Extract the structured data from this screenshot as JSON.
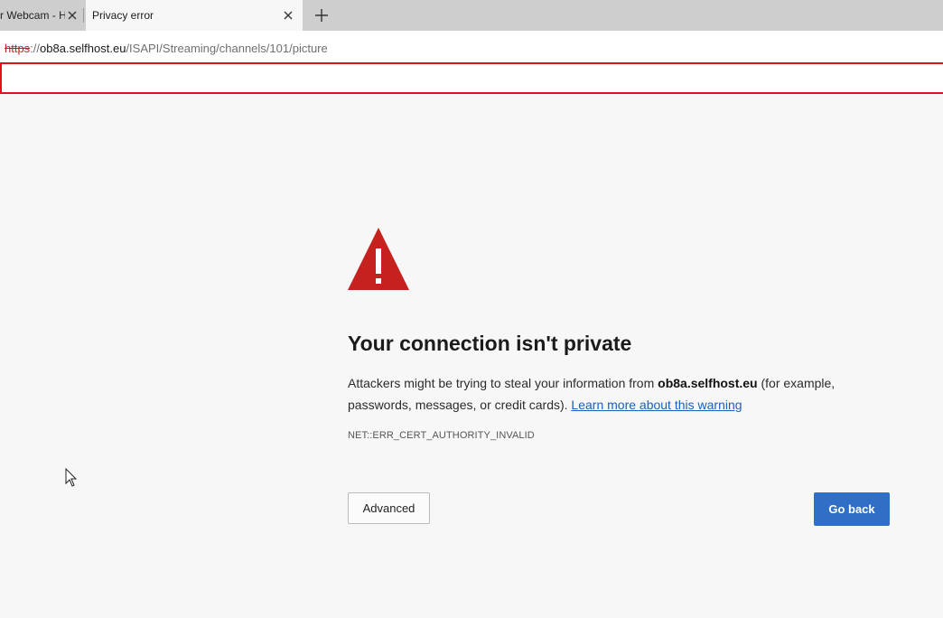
{
  "tabs": [
    {
      "title": "r Webcam - H",
      "active": false
    },
    {
      "title": "Privacy error",
      "active": true
    }
  ],
  "address_bar": {
    "scheme": "https",
    "separator": "://",
    "host": "ob8a.selfhost.eu",
    "path": "/ISAPI/Streaming/channels/101/picture"
  },
  "page": {
    "heading": "Your connection isn't private",
    "description_before": "Attackers might be trying to steal your information from ",
    "description_host": "ob8a.selfhost.eu",
    "description_after": " (for example, passwords, messages, or credit cards). ",
    "learn_more_link": "Learn more about this warning",
    "error_code": "NET::ERR_CERT_AUTHORITY_INVALID",
    "advanced_button": "Advanced",
    "go_back_button": "Go back"
  },
  "icons": {
    "warning": "warning-triangle-icon",
    "close": "close-icon",
    "new_tab": "plus-icon"
  },
  "colors": {
    "warning_red": "#c5221f",
    "button_blue": "#2f6fc5",
    "link_blue": "#1c5fbf",
    "searchbox_border": "#e0101d"
  }
}
